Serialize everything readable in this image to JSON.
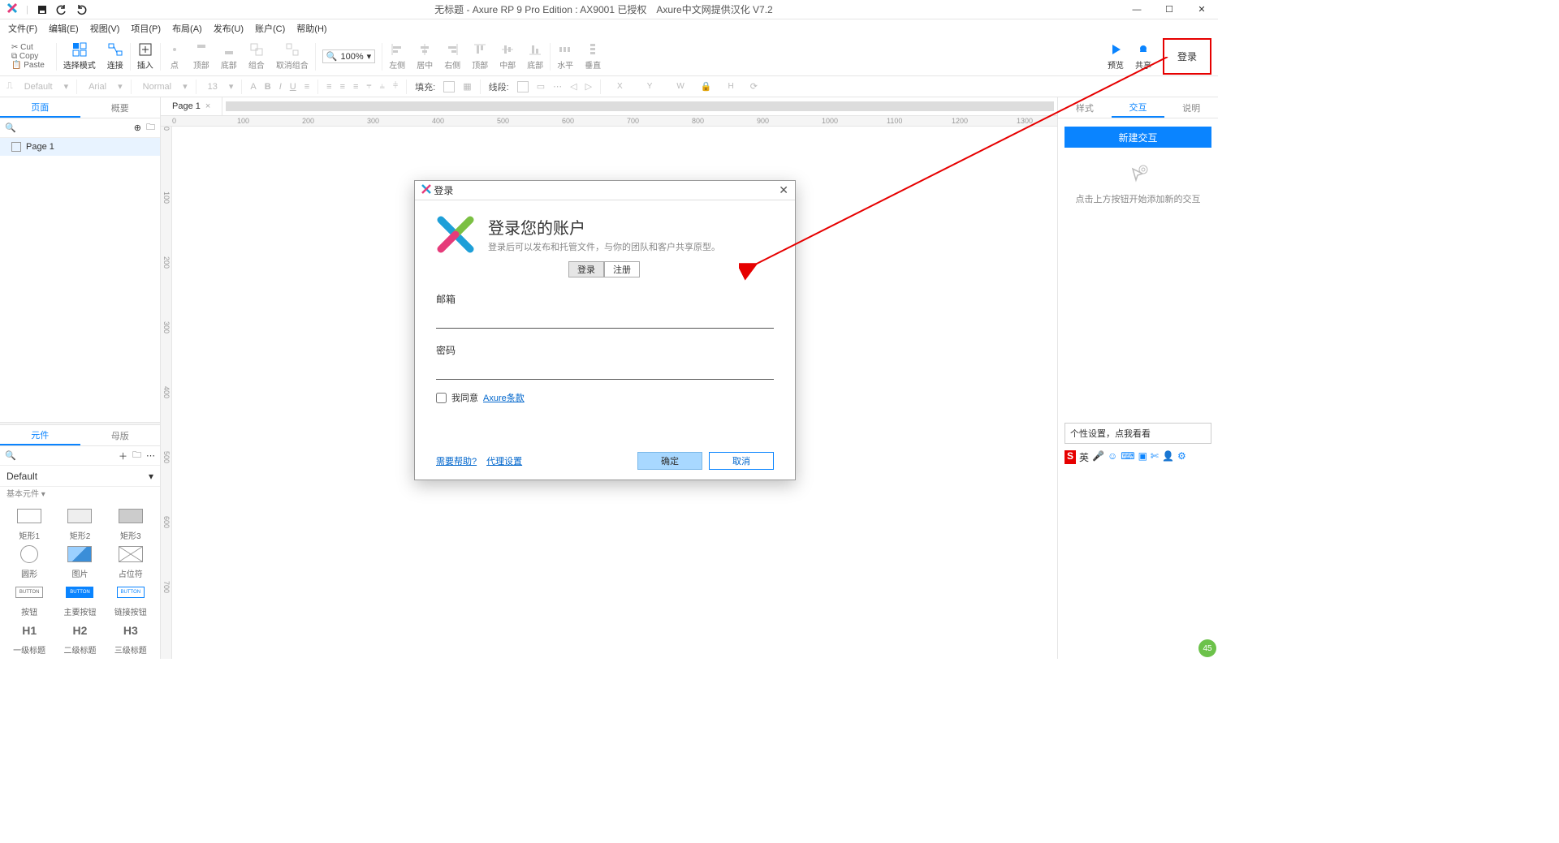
{
  "titlebar": {
    "title": "无标题 - Axure RP 9 Pro Edition : AX9001 已授权　Axure中文网提供汉化 V7.2"
  },
  "menu": [
    "文件(F)",
    "编辑(E)",
    "视图(V)",
    "项目(P)",
    "布局(A)",
    "发布(U)",
    "账户(C)",
    "帮助(H)"
  ],
  "clipboard": {
    "cut": "Cut",
    "copy": "Copy",
    "paste": "Paste"
  },
  "toolbar": {
    "select_mode": "选择模式",
    "connect": "连接",
    "insert": "插入",
    "point": "点",
    "top": "顶部",
    "bottom": "底部",
    "combine": "组合",
    "ungroup": "取消组合",
    "zoom": "100%",
    "align_left": "左侧",
    "align_center": "居中",
    "align_right": "右侧",
    "align_top2": "顶部",
    "align_middle": "中部",
    "align_bottom2": "底部",
    "dist_h": "水平",
    "dist_v": "垂直",
    "preview": "预览",
    "share": "共享",
    "login": "登录"
  },
  "formatbar": {
    "style": "Default",
    "font": "Arial",
    "weight": "Normal",
    "size": "13",
    "fill": "填充:",
    "line": "线段:",
    "x": "X",
    "y": "Y",
    "w": "W",
    "h": "H"
  },
  "left": {
    "tab_pages": "页面",
    "tab_outline": "概要",
    "page1": "Page 1",
    "tab_widgets": "元件",
    "tab_masters": "母版",
    "lib_name": "Default",
    "cat_basic": "基本元件 ▾",
    "widgets": [
      "矩形1",
      "矩形2",
      "矩形3",
      "圆形",
      "图片",
      "占位符",
      "按钮",
      "主要按钮",
      "链接按钮",
      "一级标题",
      "二级标题",
      "三级标题"
    ],
    "headings": [
      "H1",
      "H2",
      "H3"
    ]
  },
  "canvas": {
    "tab": "Page 1",
    "ruler_h": [
      "0",
      "100",
      "200",
      "300",
      "400",
      "500",
      "600",
      "700",
      "800",
      "900",
      "1000",
      "1100",
      "1200",
      "1300"
    ],
    "ruler_v": [
      "0",
      "100",
      "200",
      "300",
      "400",
      "500",
      "600",
      "700"
    ]
  },
  "right": {
    "tab_style": "样式",
    "tab_interact": "交互",
    "tab_notes": "说明",
    "new_ix": "新建交互",
    "hint": "点击上方按钮开始添加新的交互",
    "pref": "个性设置，点我看看",
    "ime": "英"
  },
  "dialog": {
    "title": "登录",
    "heading": "登录您的账户",
    "sub": "登录后可以发布和托管文件，与你的团队和客户共享原型。",
    "tab_login": "登录",
    "tab_signup": "注册",
    "email_label": "邮箱",
    "password_label": "密码",
    "agree_prefix": "我同意 ",
    "agree_link": "Axure条款",
    "help": "需要帮助?",
    "proxy": "代理设置",
    "ok": "确定",
    "cancel": "取消"
  },
  "badge": "45"
}
